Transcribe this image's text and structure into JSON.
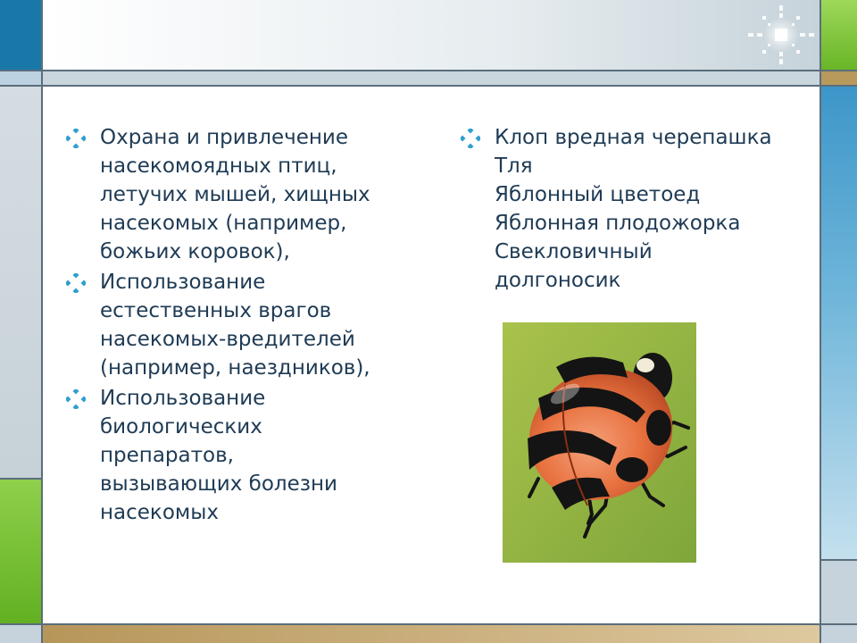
{
  "slide": {
    "left_column": {
      "items": [
        {
          "lines": [
            "Охрана и привлечение",
            "насекомоядных птиц,",
            "летучих мышей, хищных",
            "насекомых (например,",
            "божьих коровок),"
          ]
        },
        {
          "lines": [
            "Использование",
            "естественных врагов",
            "насекомых-вредителей",
            "(например, наездников),"
          ]
        },
        {
          "lines": [
            "Использование",
            "биологических",
            "препаратов,",
            "вызывающих болезни",
            "насекомых"
          ]
        }
      ]
    },
    "right_column": {
      "items": [
        {
          "lines": [
            "Клоп вредная черепашка",
            "Тля",
            "Яблонный цветоед",
            "Яблонная плодожорка",
            "Свекловичный",
            "долгоносик"
          ]
        }
      ]
    }
  },
  "icons": {
    "bullet": "diamond-bullet-icon",
    "decoration": "starburst-icon",
    "photo": "ladybug-photo"
  },
  "colors": {
    "text": "#1f3b55",
    "bullet": "#2f9fd0",
    "accent_green": "#7cc43a",
    "accent_blue": "#2d8bc0",
    "accent_tan": "#b89a5d"
  }
}
